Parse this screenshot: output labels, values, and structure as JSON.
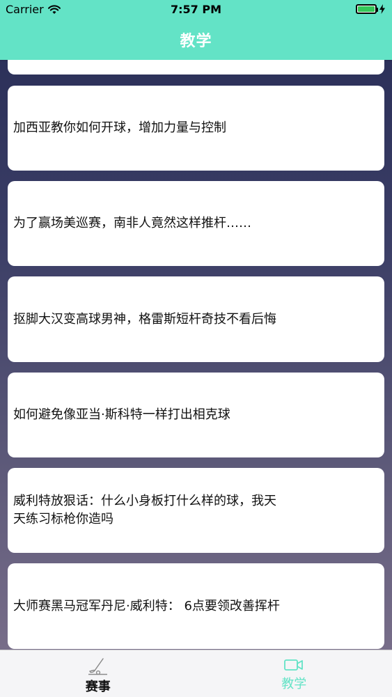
{
  "status": {
    "carrier": "Carrier",
    "time": "7:57 PM"
  },
  "nav": {
    "title": "教学"
  },
  "list": {
    "items": [
      {
        "title": "加西亚教你如何开球，增加力量与控制"
      },
      {
        "title": "为了赢场美巡赛，南非人竟然这样推杆……"
      },
      {
        "title": "抠脚大汉变高球男神，格雷斯短杆奇技不看后悔"
      },
      {
        "title": "如何避免像亚当·斯科特一样打出相克球"
      },
      {
        "title": "威利特放狠话：什么小身板打什么样的球，我天天练习标枪你造吗"
      },
      {
        "title": "大师赛黑马冠军丹尼·威利特： 6点要领改善挥杆"
      }
    ]
  },
  "tabs": [
    {
      "label": "赛事",
      "icon": "golf-club-icon"
    },
    {
      "label": "教学",
      "icon": "video-camera-icon"
    }
  ],
  "colors": {
    "accent": "#63e3c6",
    "battery": "#34c759"
  }
}
